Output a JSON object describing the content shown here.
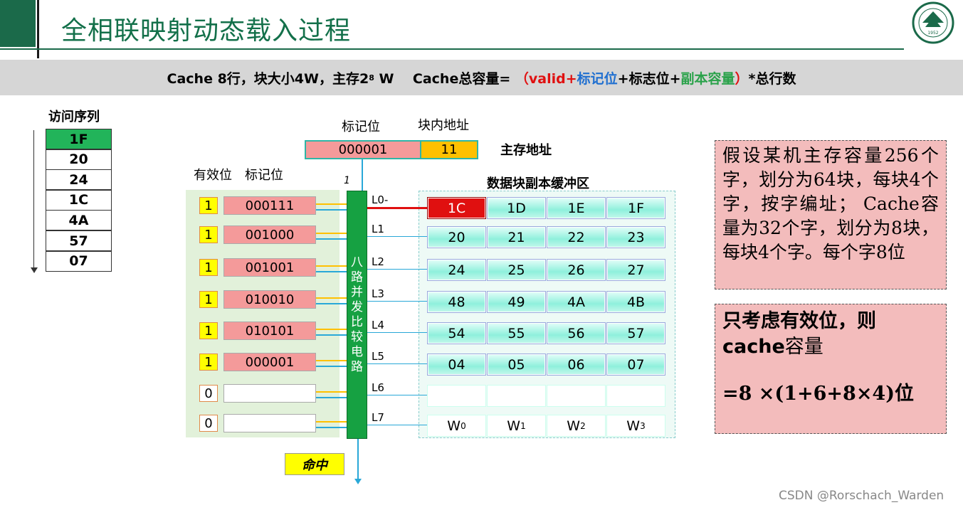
{
  "title": "全相联映射动态载入过程",
  "banner": {
    "p1": "Cache 8行，块大小4W，主存2",
    "sup": "8",
    "p2": " W    Cache总容量= ",
    "p3": "（valid+",
    "p4": "标记位",
    "p5": "+标志位+",
    "p6": "副本容量",
    "p7": "）",
    "p8": "*总行数",
    "colors": {
      "red": "#e01010",
      "blue": "#1f6fd0",
      "green": "#2aa24a"
    }
  },
  "sequence": {
    "heading": "访问序列",
    "items": [
      "1F",
      "20",
      "24",
      "1C",
      "4A",
      "57",
      "07"
    ],
    "highlight_color": "#22b45a"
  },
  "address": {
    "tag_header": "标记位",
    "offset_header": "块内地址",
    "tag": "000001",
    "offset": "11",
    "label": "主存地址",
    "bit_label": "1"
  },
  "tag_area": {
    "valid_header": "有效位",
    "tag_header": "标记位",
    "rows": [
      {
        "valid": "1",
        "tag": "000111"
      },
      {
        "valid": "1",
        "tag": "001000"
      },
      {
        "valid": "1",
        "tag": "001001"
      },
      {
        "valid": "1",
        "tag": "010010"
      },
      {
        "valid": "1",
        "tag": "010101"
      },
      {
        "valid": "1",
        "tag": "000001"
      },
      {
        "valid": "0",
        "tag": ""
      },
      {
        "valid": "0",
        "tag": ""
      }
    ]
  },
  "comparator": {
    "label": "八路并发比较电路",
    "chars": [
      "八",
      "路",
      "并",
      "发",
      "比",
      "较",
      "电",
      "路"
    ]
  },
  "line_labels": [
    "L0-",
    "L1",
    "L2",
    "L3",
    "L4",
    "L5",
    "L6",
    "L7"
  ],
  "data_area": {
    "title": "数据块副本缓冲区",
    "rows": [
      [
        "1C",
        "1D",
        "1E",
        "1F"
      ],
      [
        "20",
        "21",
        "22",
        "23"
      ],
      [
        "24",
        "25",
        "26",
        "27"
      ],
      [
        "48",
        "49",
        "4A",
        "4B"
      ],
      [
        "54",
        "55",
        "56",
        "57"
      ],
      [
        "04",
        "05",
        "06",
        "07"
      ],
      [
        "",
        "",
        "",
        ""
      ],
      [
        "W",
        "W",
        "W",
        "W"
      ]
    ],
    "word_subs": [
      "0",
      "1",
      "2",
      "3"
    ]
  },
  "hit_label": "命中",
  "info1": "假设某机主存容量256个字，划分为64块，每块4个字，按字编址；  Cache容量为32个字，划分为8块，每块4个字。每个字8位",
  "info2": {
    "line1": "只考虑有效位，则",
    "line2a": "cache",
    "line2b": "容量",
    "line3": "=8 ×(1+6+8×4)位"
  },
  "watermark": "CSDN @Rorschach_Warden",
  "logo_year": "1952"
}
